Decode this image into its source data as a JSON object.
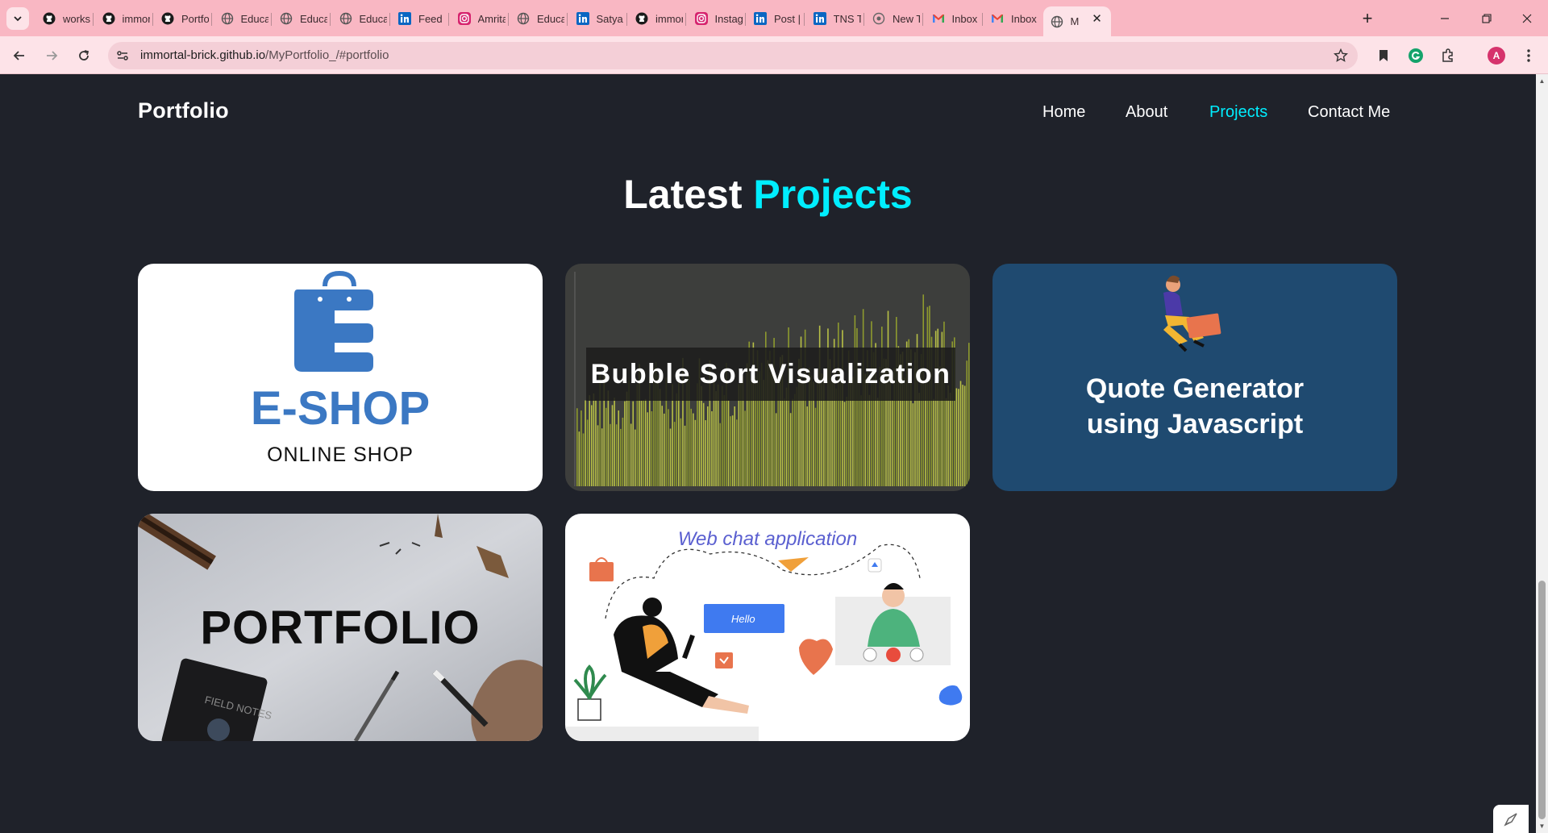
{
  "browser": {
    "tabs": [
      {
        "icon": "github-icon",
        "label": "worksh"
      },
      {
        "icon": "github-icon",
        "label": "immor"
      },
      {
        "icon": "github-icon",
        "label": "Portfo"
      },
      {
        "icon": "globe-icon",
        "label": "Educat"
      },
      {
        "icon": "globe-icon",
        "label": "Educat"
      },
      {
        "icon": "globe-icon",
        "label": "Educat"
      },
      {
        "icon": "linkedin-icon",
        "label": "Feed |"
      },
      {
        "icon": "instagram-icon",
        "label": "Amrita"
      },
      {
        "icon": "globe-icon",
        "label": "Educat"
      },
      {
        "icon": "linkedin-icon",
        "label": "Satya"
      },
      {
        "icon": "github-icon",
        "label": "immor"
      },
      {
        "icon": "instagram-icon",
        "label": "Instagr"
      },
      {
        "icon": "linkedin-icon",
        "label": "Post |"
      },
      {
        "icon": "linkedin-icon",
        "label": "TNS Te"
      },
      {
        "icon": "new-tab-icon",
        "label": "New T"
      },
      {
        "icon": "gmail-icon",
        "label": "Inbox"
      },
      {
        "icon": "gmail-icon",
        "label": "Inbox"
      },
      {
        "icon": "globe-icon",
        "label": "M"
      }
    ],
    "url_host": "immortal-brick.github.io",
    "url_path": "/MyPortfolio_/#portfolio",
    "profile_initial": "A"
  },
  "page": {
    "logo": "Portfolio",
    "nav": [
      "Home",
      "About",
      "Projects",
      "Contact Me"
    ],
    "section_title_main": "Latest",
    "section_title_accent": "Projects",
    "projects": {
      "eshop": {
        "title": "E-SHOP",
        "subtitle": "ONLINE SHOP"
      },
      "bubble": {
        "title": "Bubble Sort Visualization"
      },
      "quote": {
        "title_line1": "Quote Generator",
        "title_line2": "using Javascript"
      },
      "portfolio": {
        "title": "PORTFOLIO",
        "notebook_text": "FIELD NOTES"
      },
      "chat": {
        "title": "Web chat application",
        "bubble_text": "Hello"
      }
    }
  },
  "colors": {
    "accent": "#00eeff",
    "background": "#1f222a",
    "tabstrip": "#f9b7c3",
    "eshop_blue": "#3b78c3",
    "quote_bg": "#1f4a70"
  }
}
